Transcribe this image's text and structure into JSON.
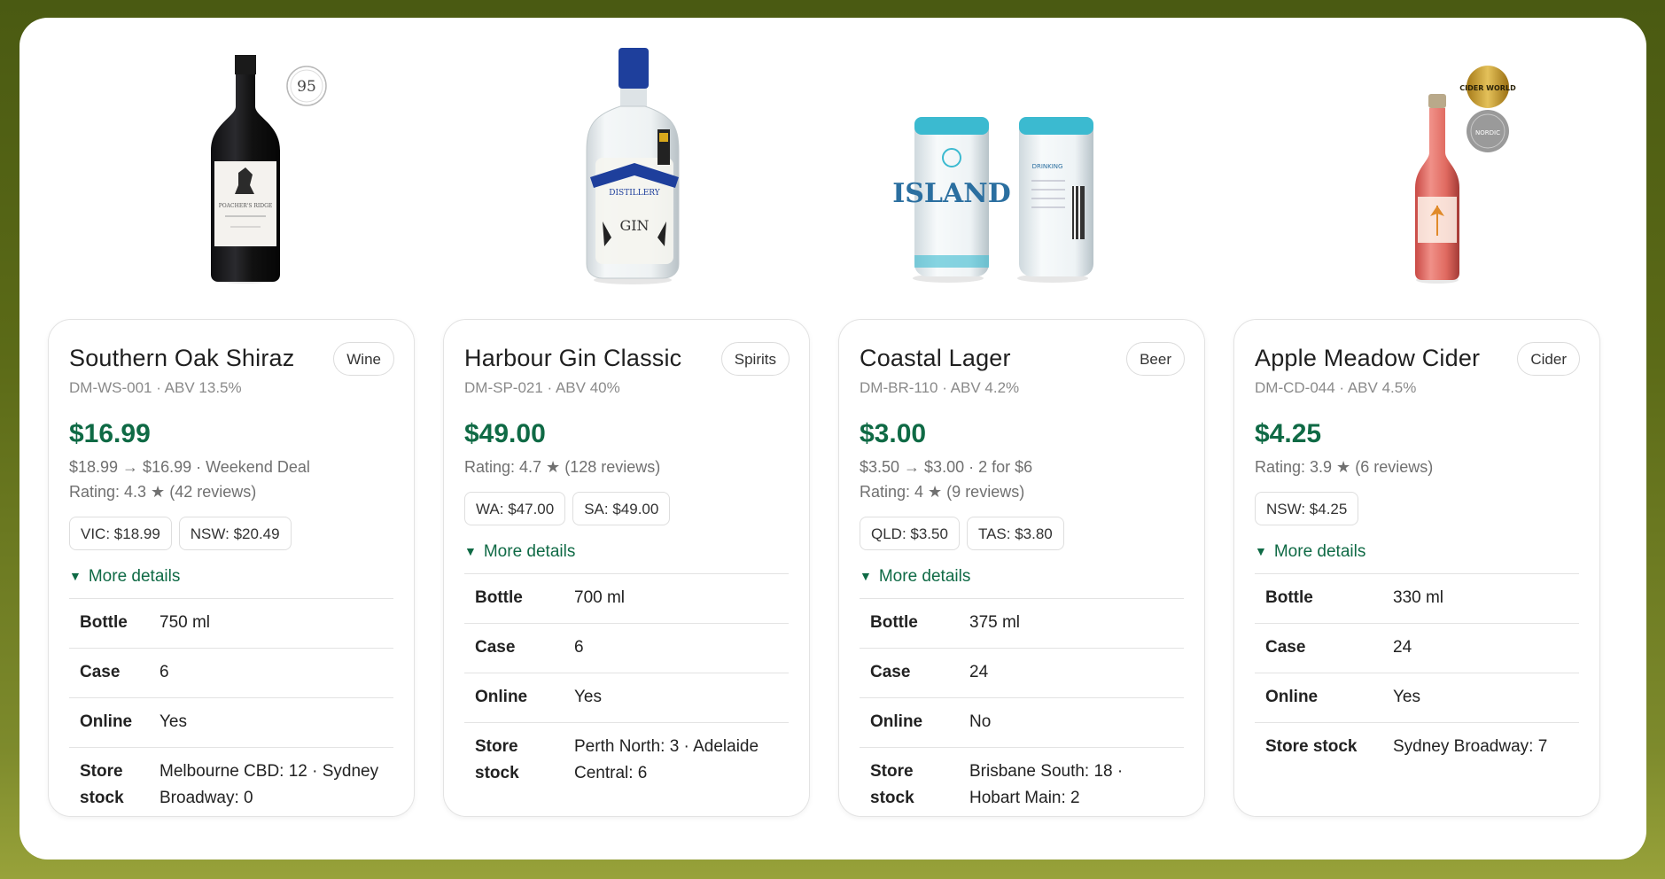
{
  "products": [
    {
      "name": "Southern Oak Shiraz",
      "category": "Wine",
      "sku_line": "DM-WS-001 · ABV 13.5%",
      "price": "$16.99",
      "deal": "$18.99 → $16.99 · Weekend Deal",
      "rating": "Rating: 4.3 ★ (42 reviews)",
      "chips": [
        "VIC: $18.99",
        "NSW: $20.49"
      ],
      "more": "More details",
      "specs": [
        {
          "k": "Bottle",
          "v": "750 ml"
        },
        {
          "k": "Case",
          "v": "6"
        },
        {
          "k": "Online",
          "v": "Yes"
        },
        {
          "k": "Store stock",
          "v": "Melbourne CBD: 12 · Sydney Broadway: 0"
        }
      ],
      "badge": "95",
      "label_text": "POACHER'S RIDGE"
    },
    {
      "name": "Harbour Gin Classic",
      "category": "Spirits",
      "sku_line": "DM-SP-021 · ABV 40%",
      "price": "$49.00",
      "rating": "Rating: 4.7 ★ (128 reviews)",
      "chips": [
        "WA: $47.00",
        "SA: $49.00"
      ],
      "more": "More details",
      "specs": [
        {
          "k": "Bottle",
          "v": "700 ml"
        },
        {
          "k": "Case",
          "v": "6"
        },
        {
          "k": "Online",
          "v": "Yes"
        },
        {
          "k": "Store stock",
          "v": "Perth North: 3 · Adelaide Central: 6"
        }
      ],
      "label_text": "GIN",
      "label_sub": "DISTILLERY"
    },
    {
      "name": "Coastal Lager",
      "category": "Beer",
      "sku_line": "DM-BR-110 · ABV 4.2%",
      "price": "$3.00",
      "deal": "$3.50 → $3.00 · 2 for $6",
      "rating": "Rating: 4 ★ (9 reviews)",
      "chips": [
        "QLD: $3.50",
        "TAS: $3.80"
      ],
      "more": "More details",
      "specs": [
        {
          "k": "Bottle",
          "v": "375 ml"
        },
        {
          "k": "Case",
          "v": "24"
        },
        {
          "k": "Online",
          "v": "No"
        },
        {
          "k": "Store stock",
          "v": "Brisbane South: 18 · Hobart Main: 2"
        }
      ],
      "label_text": "ISLAND",
      "label_sub": "DRINKING"
    },
    {
      "name": "Apple Meadow Cider",
      "category": "Cider",
      "sku_line": "DM-CD-044 · ABV 4.5%",
      "price": "$4.25",
      "rating": "Rating: 3.9 ★ (6 reviews)",
      "chips": [
        "NSW: $4.25"
      ],
      "more": "More details",
      "specs": [
        {
          "k": "Bottle",
          "v": "330 ml"
        },
        {
          "k": "Case",
          "v": "24"
        },
        {
          "k": "Online",
          "v": "Yes"
        },
        {
          "k": "Store stock",
          "v": "Sydney Broadway: 7"
        }
      ],
      "badge": "CIDER WORLD",
      "badge2": "NORDIC"
    }
  ],
  "colors": {
    "price": "#0f6a45",
    "accent": "#0f6a45"
  }
}
